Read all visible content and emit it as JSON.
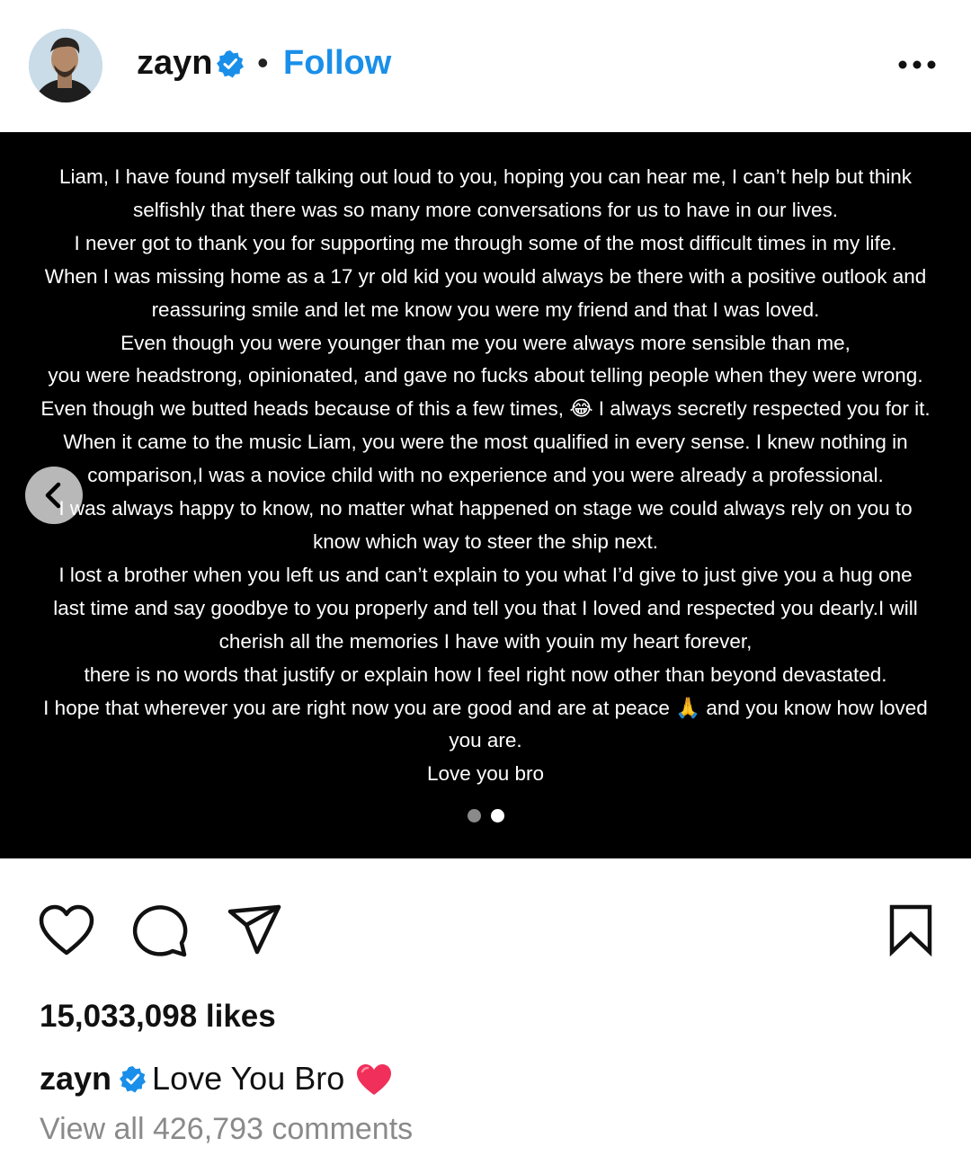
{
  "header": {
    "username": "zayn",
    "separator": "•",
    "follow_label": "Follow",
    "verified_color": "#1a8fe9",
    "more_icon": "more-dots-icon"
  },
  "post": {
    "background": "#000000",
    "text_lines": [
      "Liam, I have found myself talking out loud to you, hoping you can hear me, I can’t help but think",
      "selfishly that there was so many more conversations for us to have in our lives.",
      "I never got to thank you for supporting me through some of the most difficult times in my life.",
      "When I was missing home as a 17 yr old kid you would always be there with a positive outlook and",
      "reassuring smile and let me know you were my friend and that I was loved.",
      "Even though you were younger than me you were always more sensible than me,",
      "you were headstrong, opinionated, and gave no fucks about telling people when they were wrong.",
      "Even though we butted heads because of this a few times, 😂 I always secretly respected you for it.",
      "When it came to the music Liam, you were the most qualified in every sense. I knew nothing in",
      "comparison,I was a novice child with no experience and you were already a professional.",
      "I was always happy to know, no matter what happened on stage we could always rely on you to",
      "know which way to steer the ship next.",
      "I lost a brother when you left us and can’t explain to you what I’d give to just give you a hug one",
      "last time and say goodbye to you properly and tell you that I loved and respected you  dearly.I will",
      "cherish all the memories I have with youin my heart forever,",
      "there is no words that justify or explain how I feel right now other than beyond devastated.",
      "I hope that wherever you are right now you are good and are at peace 🙏 and you know how loved",
      "you are.",
      "Love you bro"
    ],
    "carousel": {
      "total": 2,
      "active_index": 1
    },
    "prev_icon": "chevron-left-icon"
  },
  "actions": {
    "like_icon": "heart-icon",
    "comment_icon": "comment-icon",
    "share_icon": "share-icon",
    "save_icon": "bookmark-icon"
  },
  "likes_text": "15,033,098 likes",
  "caption": {
    "username": "zayn",
    "text": "Love You Bro",
    "emoji_icon": "red-heart-icon",
    "heart_color": "#f0305a"
  },
  "view_comments": "View all 426,793 comments"
}
